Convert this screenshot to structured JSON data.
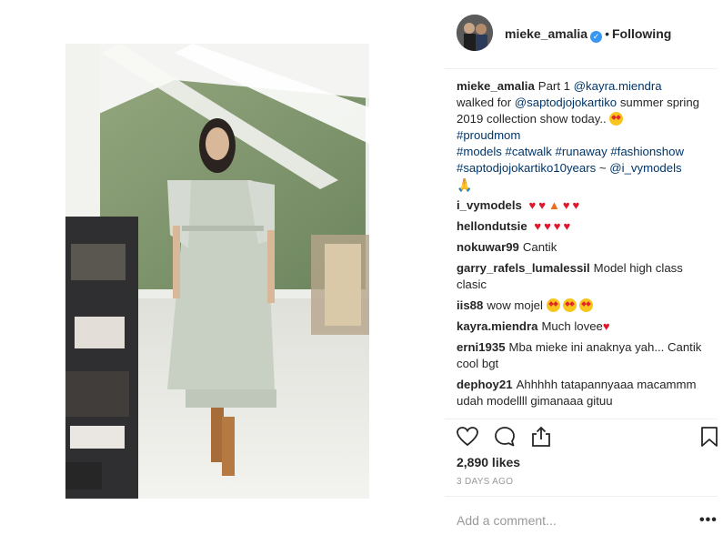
{
  "post": {
    "author": "mieke_amalia",
    "follow_status": "Following",
    "separator": "•",
    "verified_icon": "check-icon"
  },
  "caption": {
    "user": "mieke_amalia",
    "text_1": "Part 1",
    "mention_1": "@kayra.miendra",
    "text_2": "walked for",
    "mention_2": "@saptodjojokartiko",
    "text_3": "summer spring 2019 collection show today..",
    "hashtag_1": "#proudmom",
    "hashtags_2": "#models #catwalk #runaway #fashionshow",
    "hashtags_3": "#saptodjojokartiko10years",
    "tilde": "~",
    "mention_3": "@i_vymodels"
  },
  "comments": [
    {
      "user": "i_vymodels",
      "text": ""
    },
    {
      "user": "hellondutsie",
      "text": ""
    },
    {
      "user": "nokuwar99",
      "text": "Cantik"
    },
    {
      "user": "garry_rafels_lumalessil",
      "text": "Model high class clasic"
    },
    {
      "user": "iis88",
      "text": "wow mojel"
    },
    {
      "user": "kayra.miendra",
      "text": "Much lovee"
    },
    {
      "user": "erni1935",
      "text": "Mba mieke ini anaknya yah... Cantik cool bgt"
    },
    {
      "user": "dephoy21",
      "text": "Ahhhhh tatapannyaaa macammm udah modellll gimanaaa gituu"
    }
  ],
  "likes": "2,890 likes",
  "date": "3 DAYS AGO",
  "add_comment_placeholder": "Add a comment...",
  "more_label": "•••",
  "colors": {
    "link": "#003569",
    "heart": "#e0162b",
    "verified": "#3897f0",
    "muted": "#999999"
  }
}
